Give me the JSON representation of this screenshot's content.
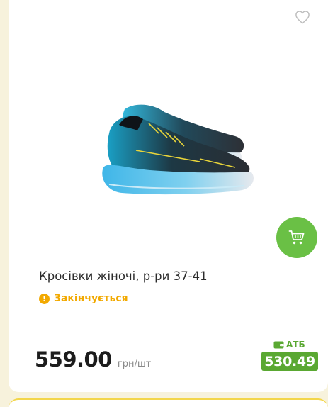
{
  "product": {
    "title": "Кросівки жіночі, р-ри 37-41",
    "stock_status": "Закінчується",
    "stock_icon": "exclamation-icon",
    "price": "559.00",
    "price_unit": "грн/шт",
    "atb_label": "АТБ",
    "atb_price": "530.49",
    "image": "sneaker-photo"
  },
  "icons": {
    "wishlist": "heart-outline-icon",
    "cart": "cart-icon",
    "wallet": "wallet-icon"
  },
  "colors": {
    "accent_green": "#6ac045",
    "atb_green": "#5aa832",
    "stock_amber": "#f2a900",
    "page_bg": "#f7f2dc"
  }
}
